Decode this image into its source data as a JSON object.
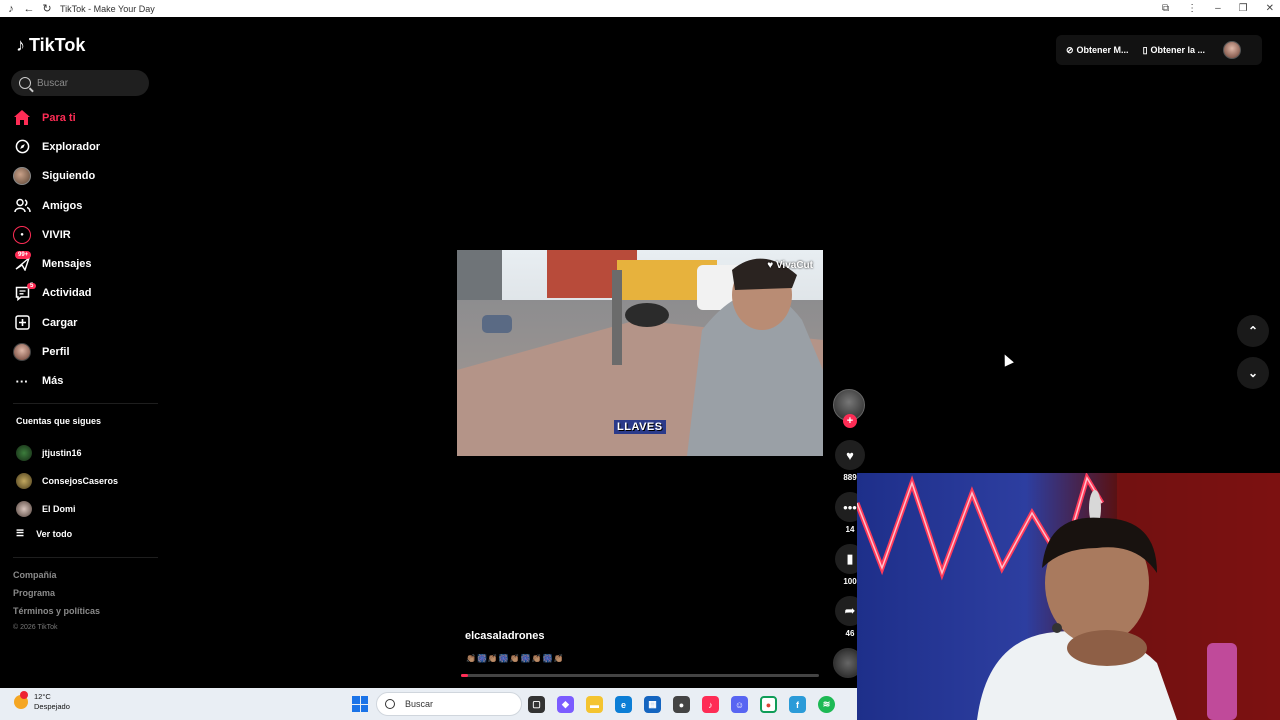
{
  "window": {
    "title": "TikTok - Make Your Day"
  },
  "app": {
    "logo_text": "TikTok"
  },
  "search": {
    "placeholder": "Buscar"
  },
  "nav": {
    "items": [
      {
        "label": "Para ti",
        "icon": "home-icon"
      },
      {
        "label": "Explorador",
        "icon": "compass-icon"
      },
      {
        "label": "Siguiendo",
        "icon": "following-avatar-icon"
      },
      {
        "label": "Amigos",
        "icon": "friends-icon"
      },
      {
        "label": "VIVIR",
        "icon": "live-icon"
      },
      {
        "label": "Mensajes",
        "icon": "messages-icon",
        "badge": "99+"
      },
      {
        "label": "Actividad",
        "icon": "activity-icon",
        "badge": "5"
      },
      {
        "label": "Cargar",
        "icon": "upload-icon"
      },
      {
        "label": "Perfil",
        "icon": "profile-avatar-icon"
      },
      {
        "label": "Más",
        "icon": "more-icon"
      }
    ]
  },
  "following": {
    "title": "Cuentas que sigues",
    "accounts": [
      "jtjustin16",
      "ConsejosCaseros",
      "El Domi"
    ],
    "see_all": "Ver todo"
  },
  "footer": {
    "links": [
      "Compañía",
      "Programa",
      "Términos y políticas"
    ],
    "copyright": "© 2026 TikTok"
  },
  "header_actions": {
    "get_coins": "Obtener M...",
    "get_app": "Obtener la ..."
  },
  "video": {
    "watermark": "VivaCut",
    "overlay_text": "LLAVES",
    "author": "elcasaladrones",
    "caption": "👏🏽🎆👏🏽🎆👏🏽🎆👏🏽🎆👏🏽",
    "progress": 0.02
  },
  "actions": {
    "likes": "889",
    "comments": "14",
    "saves": "100",
    "shares": "46"
  },
  "taskbar": {
    "temperature": "12°C",
    "weather": "Despejado",
    "search_placeholder": "Buscar"
  },
  "colors": {
    "accent": "#fe2c55",
    "background": "#000000",
    "taskbar": "#e9eef4"
  }
}
